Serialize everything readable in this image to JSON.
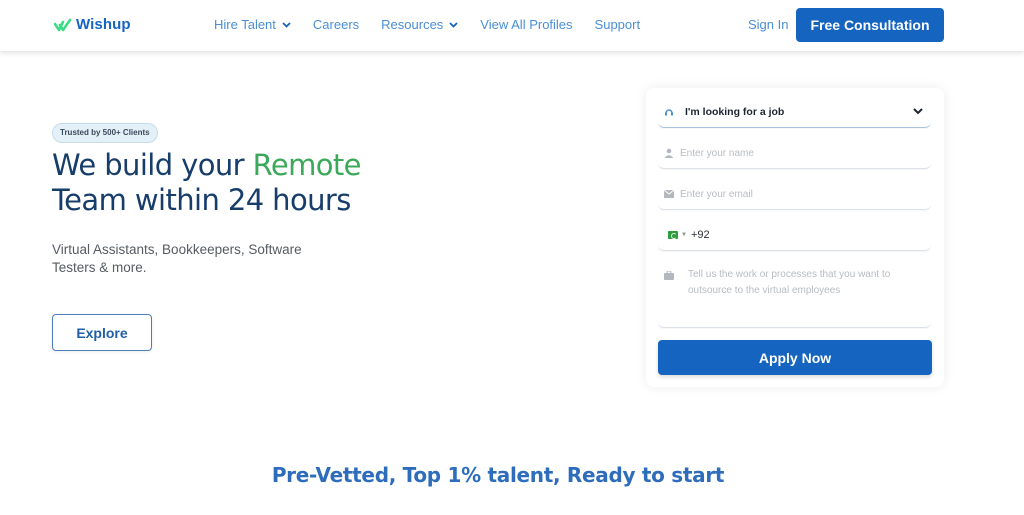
{
  "header": {
    "logo_text": "Wishup",
    "nav": [
      {
        "label": "Hire Talent",
        "has_dropdown": true
      },
      {
        "label": "Careers",
        "has_dropdown": false
      },
      {
        "label": "Resources",
        "has_dropdown": true
      },
      {
        "label": "View All Profiles",
        "has_dropdown": false
      },
      {
        "label": "Support",
        "has_dropdown": false
      }
    ],
    "sign_in": "Sign In",
    "cta": "Free Consultation"
  },
  "hero": {
    "badge": "Trusted by 500+ Clients",
    "title_part1": "We build your ",
    "title_accent": "Remote",
    "title_part2": "Team within 24 hours",
    "subtitle": "Virtual Assistants, Bookkeepers, Software Testers & more.",
    "explore": "Explore"
  },
  "form": {
    "select_value": "I'm looking for a job",
    "name_placeholder": "Enter your name",
    "email_placeholder": "Enter your email",
    "phone_code": "+92",
    "message_placeholder": "Tell us the work or processes that you want to outsource to the virtual employees",
    "submit": "Apply Now"
  },
  "section": {
    "title": "Pre-Vetted, Top 1% talent, Ready to start"
  },
  "colors": {
    "brand_blue": "#1565c0",
    "nav_blue": "#4a8fd6",
    "accent_green": "#3ca85a",
    "heading_navy": "#173d6b"
  }
}
